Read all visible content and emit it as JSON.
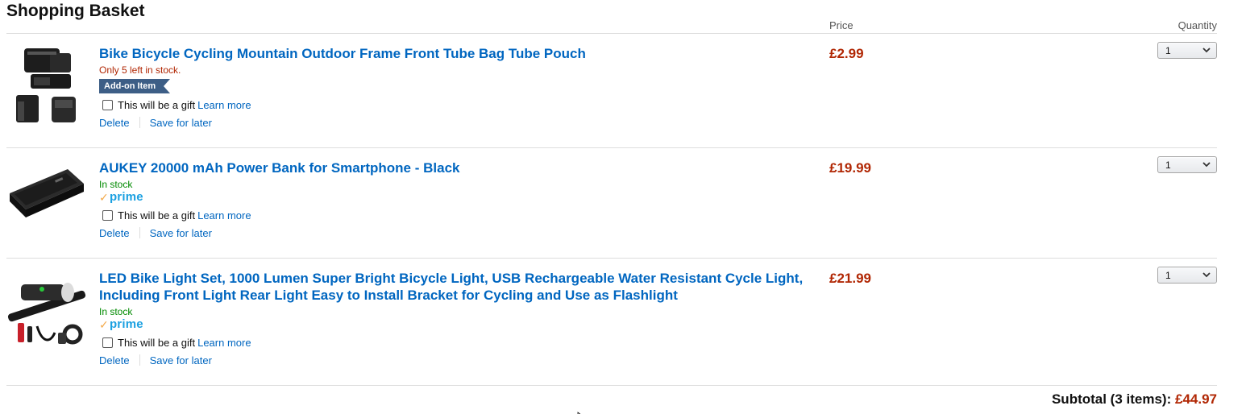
{
  "page": {
    "title": "Shopping Basket",
    "price_header": "Price",
    "quantity_header": "Quantity"
  },
  "items": [
    {
      "title": "Bike Bicycle Cycling Mountain Outdoor Frame Front Tube Bag Tube Pouch",
      "stock": "Only 5 left in stock.",
      "badge": "Add-on Item",
      "gift_label": "This will be a gift",
      "gift_link": "Learn more",
      "delete": "Delete",
      "save_for_later": "Save for later",
      "price": "£2.99",
      "quantity": "1",
      "image_icon": "bike-bag-image"
    },
    {
      "title": "AUKEY 20000 mAh Power Bank for Smartphone - Black",
      "stock": "In stock",
      "prime": "prime",
      "gift_label": "This will be a gift",
      "gift_link": "Learn more",
      "delete": "Delete",
      "save_for_later": "Save for later",
      "price": "£19.99",
      "quantity": "1",
      "image_icon": "power-bank-image"
    },
    {
      "title_line1": "LED Bike Light Set, 1000 Lumen Super Bright Bicycle Light, USB Rechargeable Water Resistant Cycle Light,",
      "title_line2": "Including Front Light Rear Light Easy to Install Bracket for Cycling and Use as Flashlight",
      "stock": "In stock",
      "prime": "prime",
      "gift_label": "This will be a gift",
      "gift_link": "Learn more",
      "delete": "Delete",
      "save_for_later": "Save for later",
      "price": "£21.99",
      "quantity": "1",
      "image_icon": "bike-light-image"
    }
  ],
  "subtotal": {
    "label": "Subtotal (3 items):",
    "amount": "£44.97"
  },
  "colors": {
    "link": "#0066c0",
    "price": "#b12704",
    "in_stock": "#008a00",
    "prime": "#1ba0e1",
    "addon_badge": "#3d5e86"
  }
}
